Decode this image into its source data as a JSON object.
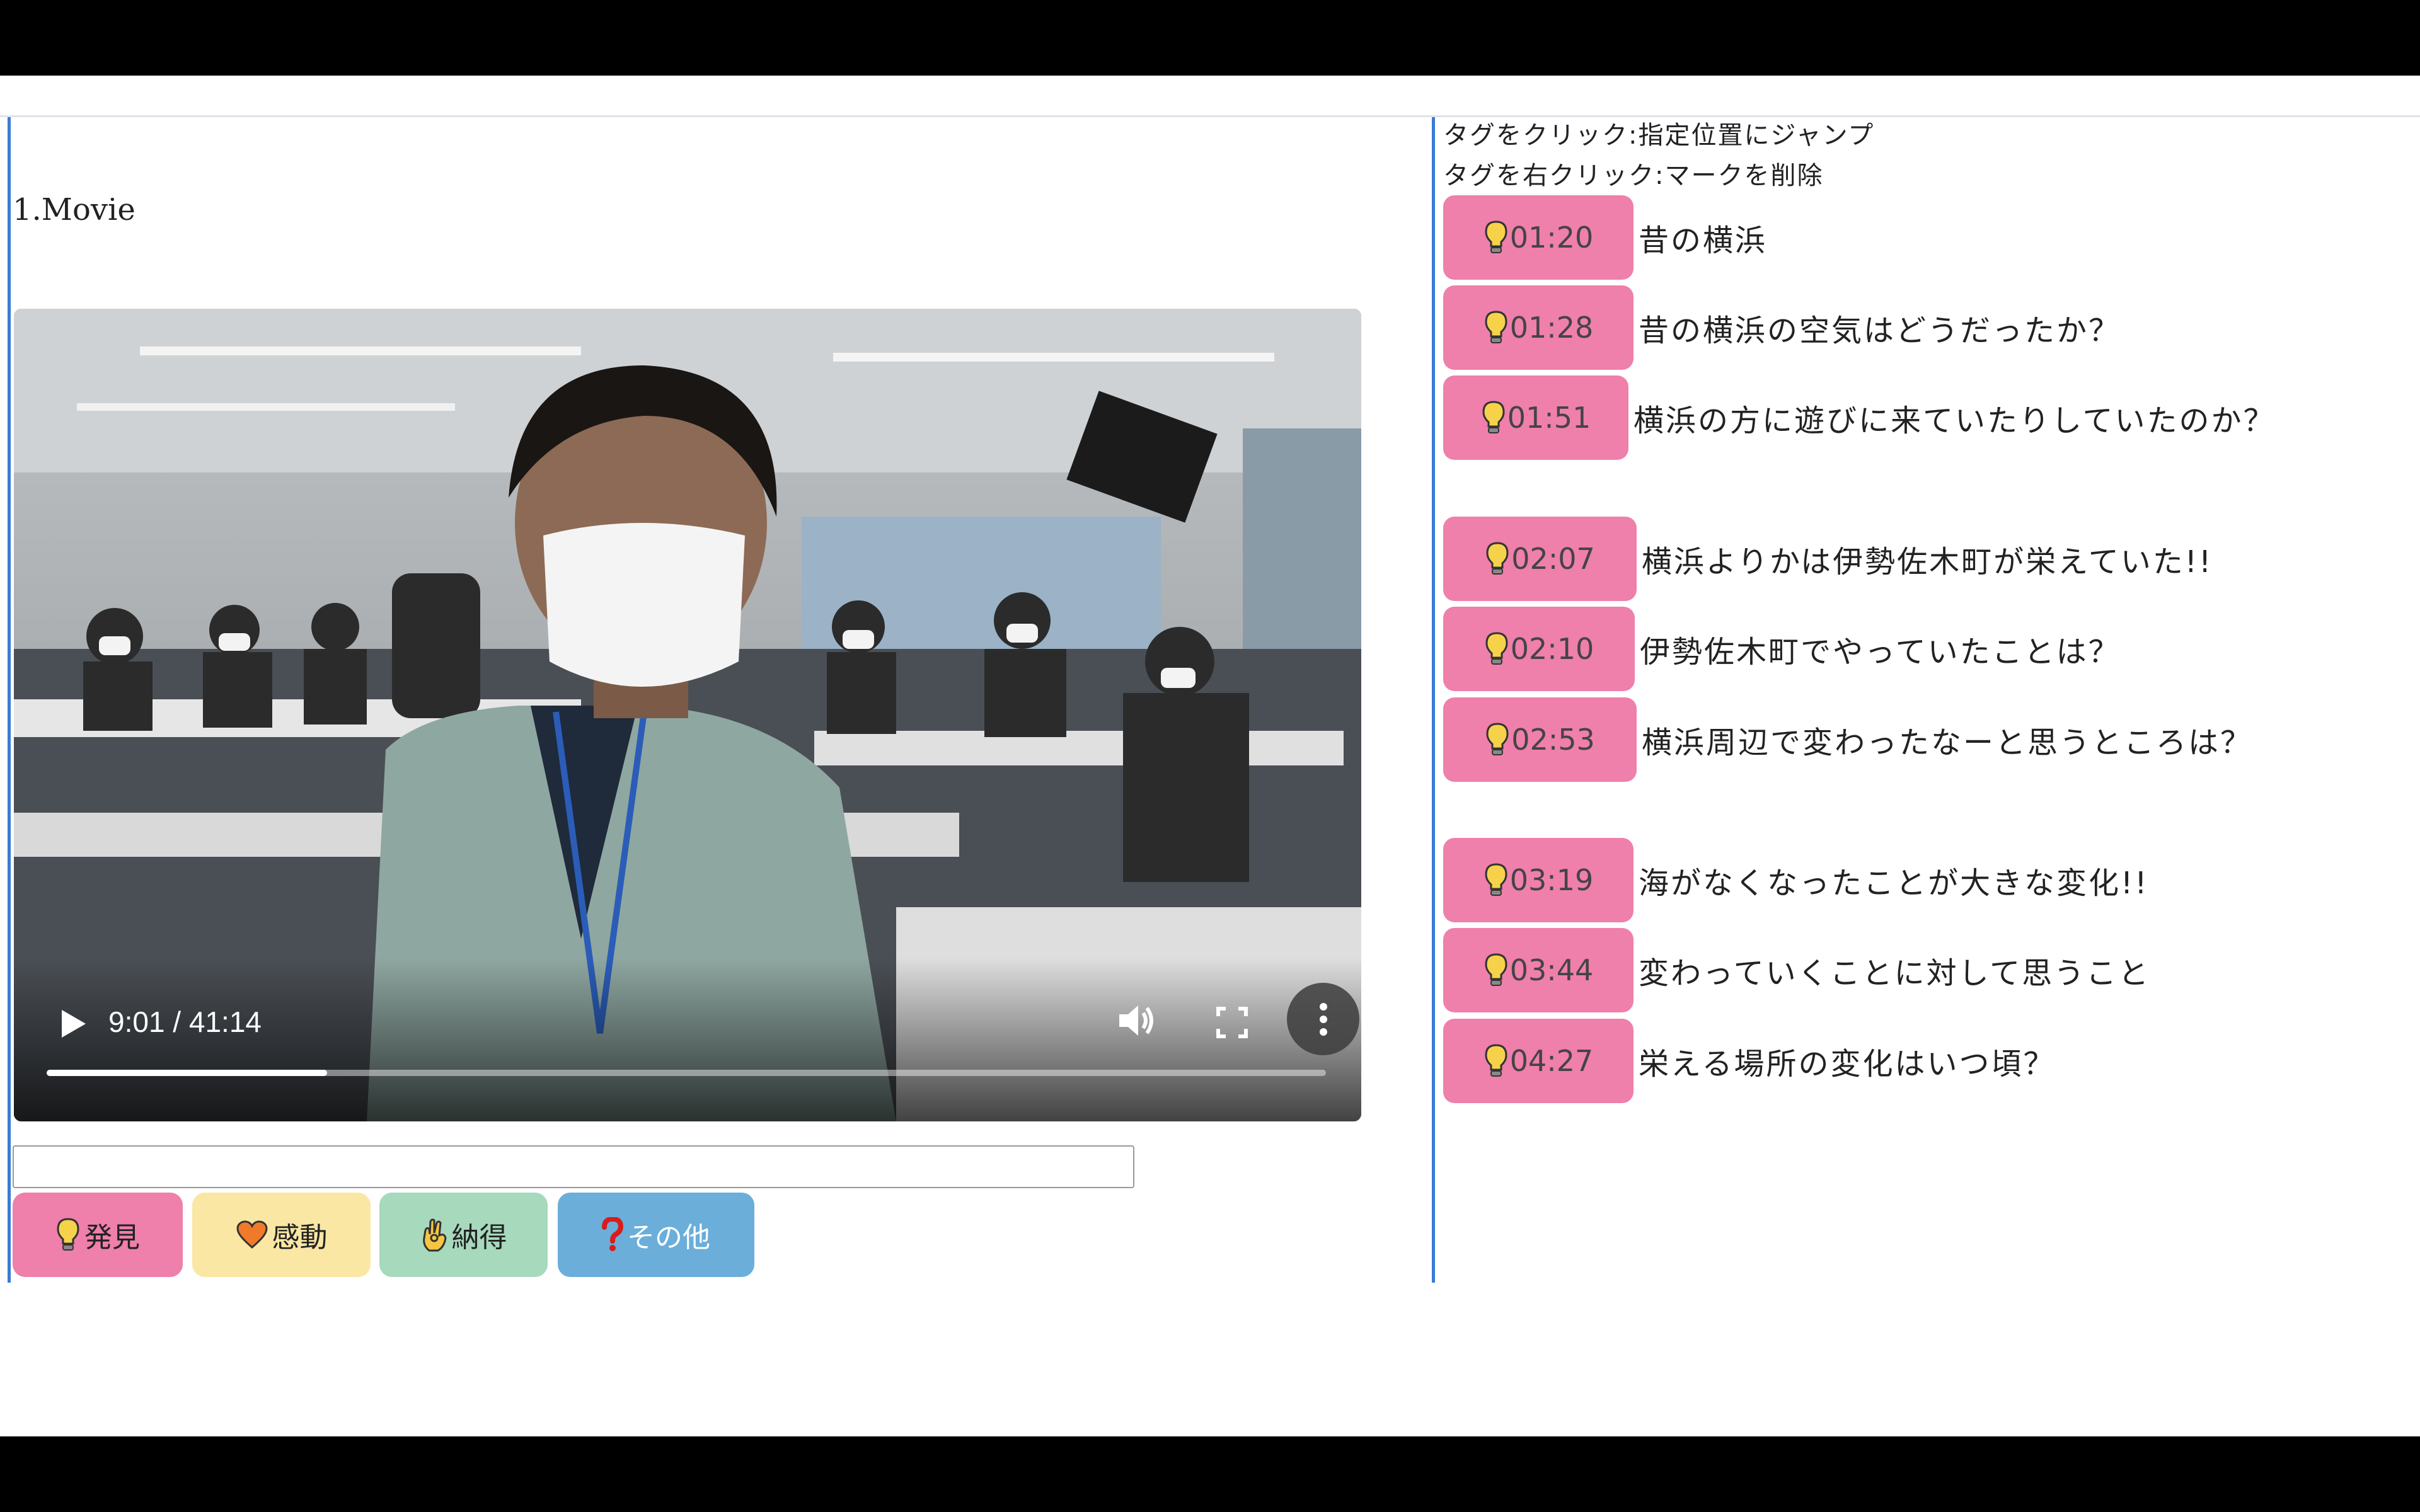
{
  "section": {
    "title": "1.Movie"
  },
  "video": {
    "time_display": "9:01 / 41:14",
    "progress_fraction": 0.219
  },
  "note_input": {
    "value": "",
    "placeholder": ""
  },
  "tag_buttons": [
    {
      "id": "discovery",
      "label": "発見",
      "icon": "lightbulb-icon",
      "color": "#ef7fab"
    },
    {
      "id": "moved",
      "label": "感動",
      "icon": "heart-icon",
      "color": "#fbe7a4"
    },
    {
      "id": "convinced",
      "label": "納得",
      "icon": "ok-hand-icon",
      "color": "#a7d9bd"
    },
    {
      "id": "other",
      "label": "その他",
      "icon": "question-icon",
      "color": "#6aaed9"
    }
  ],
  "hints": {
    "click": "タグをクリック:指定位置にジャンプ",
    "right_click": "タグを右クリック:マークを削除"
  },
  "tags": [
    {
      "time": "01:20",
      "text": "昔の横浜"
    },
    {
      "time": "01:28",
      "text": "昔の横浜の空気はどうだったか？"
    },
    {
      "time": "01:51",
      "text": "横浜の方に遊びに来ていたりしていたのか？"
    },
    {
      "time": "02:07",
      "text": "横浜よりかは伊勢佐木町が栄えていた!!"
    },
    {
      "time": "02:10",
      "text": "伊勢佐木町でやっていたことは？"
    },
    {
      "time": "02:53",
      "text": "横浜周辺で変わったなーと思うところは？"
    },
    {
      "time": "03:19",
      "text": "海がなくなったことが大きな変化!!"
    },
    {
      "time": "03:44",
      "text": "変わっていくことに対して思うこと"
    },
    {
      "time": "04:27",
      "text": "栄える場所の変化はいつ頃？"
    }
  ]
}
